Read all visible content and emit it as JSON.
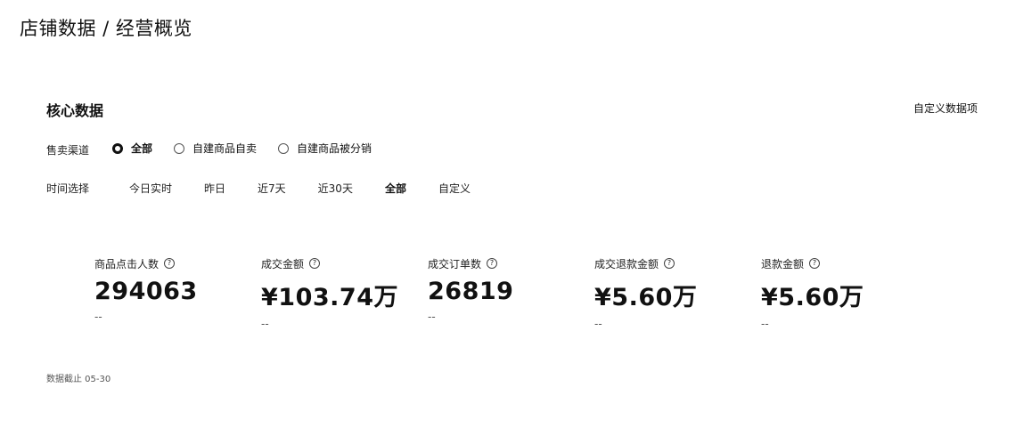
{
  "page": {
    "title": "店铺数据 / 经营概览"
  },
  "section": {
    "title": "核心数据",
    "customize_label": "自定义数据项"
  },
  "channel": {
    "label": "售卖渠道",
    "options": [
      "全部",
      "自建商品自卖",
      "自建商品被分销"
    ],
    "selected": "全部"
  },
  "time": {
    "label": "时间选择",
    "options": [
      "今日实时",
      "昨日",
      "近7天",
      "近30天",
      "全部",
      "自定义"
    ],
    "selected": "全部"
  },
  "metrics": [
    {
      "label": "商品点击人数",
      "value": "294063",
      "compare": "--"
    },
    {
      "label": "成交金额",
      "value": "¥103.74万",
      "compare": "--"
    },
    {
      "label": "成交订单数",
      "value": "26819",
      "compare": "--"
    },
    {
      "label": "成交退款金额",
      "value": "¥5.60万",
      "compare": "--"
    },
    {
      "label": "退款金额",
      "value": "¥5.60万",
      "compare": "--"
    }
  ],
  "footer": {
    "note": "数据截止 05-30"
  }
}
